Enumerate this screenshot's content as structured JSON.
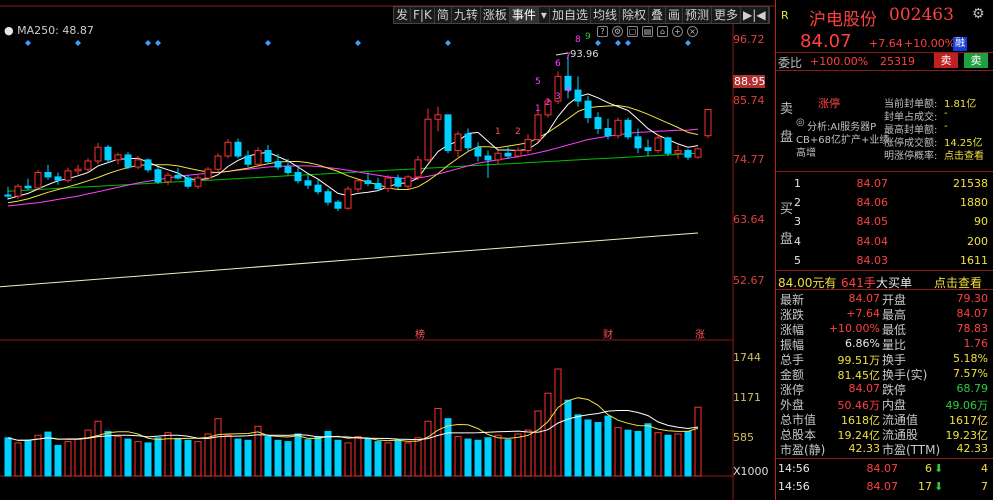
{
  "chart": {
    "ma_legend": "MA250: 48.87",
    "toolbar": [
      "发",
      "F|K",
      "简",
      "九转",
      "涨板",
      "事件",
      "▾",
      "加自选",
      "均线",
      "除权",
      "叠",
      "画",
      "预测",
      "更多",
      "▶|◀"
    ],
    "price_axis": [
      "96.72",
      "88.95",
      "85.74",
      "74.77",
      "63.64",
      "52.67"
    ],
    "vol_axis": [
      "1744",
      "1171",
      "585",
      "X1000"
    ],
    "peak_label": "93.96",
    "event_labels": [
      "榜",
      "财",
      "涨"
    ],
    "nine_turn_up": [
      "1",
      "2",
      "1",
      "2",
      "3",
      "4",
      "5",
      "6",
      "7",
      "8",
      "9"
    ],
    "colors": {
      "up": "#ff3030",
      "down": "#00d0ff",
      "ma5": "#ffffff",
      "ma10": "#f0e040",
      "ma20": "#ff40ff",
      "ma60": "#00c000",
      "ma250": "#f0f0c0"
    }
  },
  "chart_data": {
    "type": "candlestick",
    "price_range": [
      48,
      100
    ],
    "volume_range": [
      0,
      2000
    ],
    "candles": [
      {
        "o": 68.5,
        "h": 70.0,
        "l": 67.6,
        "c": 68.3
      },
      {
        "o": 68.3,
        "h": 70.5,
        "l": 67.8,
        "c": 70.1
      },
      {
        "o": 70.1,
        "h": 71.5,
        "l": 69.4,
        "c": 69.8
      },
      {
        "o": 69.8,
        "h": 73.0,
        "l": 69.4,
        "c": 72.6
      },
      {
        "o": 72.6,
        "h": 74.0,
        "l": 71.3,
        "c": 71.8
      },
      {
        "o": 71.8,
        "h": 72.6,
        "l": 70.4,
        "c": 71.2
      },
      {
        "o": 71.2,
        "h": 73.5,
        "l": 70.8,
        "c": 72.9
      },
      {
        "o": 72.9,
        "h": 74.0,
        "l": 72.2,
        "c": 73.2
      },
      {
        "o": 73.2,
        "h": 75.2,
        "l": 72.6,
        "c": 74.7
      },
      {
        "o": 74.7,
        "h": 78.0,
        "l": 74.1,
        "c": 77.2
      },
      {
        "o": 77.2,
        "h": 77.6,
        "l": 74.4,
        "c": 74.9
      },
      {
        "o": 74.9,
        "h": 76.2,
        "l": 74.1,
        "c": 75.8
      },
      {
        "o": 75.8,
        "h": 76.3,
        "l": 73.2,
        "c": 73.6
      },
      {
        "o": 73.6,
        "h": 75.6,
        "l": 73.2,
        "c": 74.9
      },
      {
        "o": 74.9,
        "h": 75.2,
        "l": 72.6,
        "c": 73.1
      },
      {
        "o": 73.1,
        "h": 73.6,
        "l": 70.5,
        "c": 70.9
      },
      {
        "o": 70.9,
        "h": 72.6,
        "l": 70.3,
        "c": 72.1
      },
      {
        "o": 72.1,
        "h": 73.4,
        "l": 71.3,
        "c": 71.6
      },
      {
        "o": 71.6,
        "h": 72.2,
        "l": 69.7,
        "c": 70.1
      },
      {
        "o": 70.1,
        "h": 72.1,
        "l": 69.6,
        "c": 71.6
      },
      {
        "o": 71.6,
        "h": 73.6,
        "l": 71.2,
        "c": 73.2
      },
      {
        "o": 73.2,
        "h": 76.1,
        "l": 72.6,
        "c": 75.6
      },
      {
        "o": 75.6,
        "h": 78.7,
        "l": 75.2,
        "c": 78.1
      },
      {
        "o": 78.1,
        "h": 78.8,
        "l": 75.2,
        "c": 75.6
      },
      {
        "o": 75.6,
        "h": 76.6,
        "l": 73.6,
        "c": 74.1
      },
      {
        "o": 74.1,
        "h": 77.2,
        "l": 73.6,
        "c": 76.6
      },
      {
        "o": 76.6,
        "h": 77.6,
        "l": 74.1,
        "c": 74.6
      },
      {
        "o": 74.6,
        "h": 76.0,
        "l": 73.1,
        "c": 73.6
      },
      {
        "o": 73.6,
        "h": 75.1,
        "l": 72.1,
        "c": 72.6
      },
      {
        "o": 72.6,
        "h": 73.6,
        "l": 70.6,
        "c": 71.1
      },
      {
        "o": 71.1,
        "h": 72.1,
        "l": 69.6,
        "c": 70.3
      },
      {
        "o": 70.3,
        "h": 71.3,
        "l": 68.6,
        "c": 69.1
      },
      {
        "o": 69.1,
        "h": 69.6,
        "l": 66.6,
        "c": 67.2
      },
      {
        "o": 67.2,
        "h": 67.6,
        "l": 65.6,
        "c": 66.1
      },
      {
        "o": 66.1,
        "h": 70.1,
        "l": 65.8,
        "c": 69.6
      },
      {
        "o": 69.6,
        "h": 71.6,
        "l": 69.1,
        "c": 71.1
      },
      {
        "o": 71.1,
        "h": 72.6,
        "l": 70.1,
        "c": 70.6
      },
      {
        "o": 70.6,
        "h": 71.6,
        "l": 69.2,
        "c": 69.7
      },
      {
        "o": 69.7,
        "h": 72.1,
        "l": 69.1,
        "c": 71.6
      },
      {
        "o": 71.6,
        "h": 72.2,
        "l": 69.6,
        "c": 70.1
      },
      {
        "o": 70.1,
        "h": 72.1,
        "l": 69.6,
        "c": 71.8
      },
      {
        "o": 71.8,
        "h": 75.6,
        "l": 71.2,
        "c": 74.9
      },
      {
        "o": 74.9,
        "h": 84.2,
        "l": 74.6,
        "c": 82.3
      },
      {
        "o": 82.3,
        "h": 84.6,
        "l": 80.1,
        "c": 83.1
      },
      {
        "o": 83.1,
        "h": 82.4,
        "l": 76.1,
        "c": 76.6
      },
      {
        "o": 76.6,
        "h": 80.1,
        "l": 75.1,
        "c": 79.6
      },
      {
        "o": 79.6,
        "h": 80.6,
        "l": 76.4,
        "c": 77.1
      },
      {
        "o": 77.1,
        "h": 78.1,
        "l": 74.6,
        "c": 75.6
      },
      {
        "o": 75.6,
        "h": 76.6,
        "l": 71.6,
        "c": 74.9
      },
      {
        "o": 74.9,
        "h": 76.6,
        "l": 74.1,
        "c": 76.1
      },
      {
        "o": 76.1,
        "h": 77.2,
        "l": 75.1,
        "c": 75.6
      },
      {
        "o": 75.6,
        "h": 77.2,
        "l": 75.2,
        "c": 76.6
      },
      {
        "o": 76.6,
        "h": 79.6,
        "l": 76.1,
        "c": 78.6
      },
      {
        "o": 78.6,
        "h": 84.1,
        "l": 78.1,
        "c": 83.1
      },
      {
        "o": 83.1,
        "h": 86.1,
        "l": 82.6,
        "c": 85.6
      },
      {
        "o": 85.6,
        "h": 91.0,
        "l": 85.1,
        "c": 90.1
      },
      {
        "o": 90.1,
        "h": 93.96,
        "l": 86.1,
        "c": 87.6
      },
      {
        "o": 87.6,
        "h": 90.1,
        "l": 84.6,
        "c": 85.6
      },
      {
        "o": 85.6,
        "h": 86.6,
        "l": 81.6,
        "c": 82.6
      },
      {
        "o": 82.6,
        "h": 83.6,
        "l": 79.6,
        "c": 80.6
      },
      {
        "o": 80.6,
        "h": 82.4,
        "l": 78.6,
        "c": 79.3
      },
      {
        "o": 79.3,
        "h": 82.6,
        "l": 78.8,
        "c": 82.1
      },
      {
        "o": 82.1,
        "h": 82.6,
        "l": 78.6,
        "c": 79.1
      },
      {
        "o": 79.1,
        "h": 80.6,
        "l": 76.1,
        "c": 77.1
      },
      {
        "o": 77.1,
        "h": 78.6,
        "l": 75.6,
        "c": 76.6
      },
      {
        "o": 76.6,
        "h": 79.6,
        "l": 76.1,
        "c": 78.9
      },
      {
        "o": 78.9,
        "h": 79.1,
        "l": 75.6,
        "c": 76.1
      },
      {
        "o": 76.1,
        "h": 77.6,
        "l": 75.1,
        "c": 76.6
      },
      {
        "o": 76.6,
        "h": 76.9,
        "l": 74.9,
        "c": 75.4
      },
      {
        "o": 75.4,
        "h": 77.1,
        "l": 75.1,
        "c": 76.9
      },
      {
        "o": 79.3,
        "h": 84.07,
        "l": 78.83,
        "c": 84.07
      }
    ],
    "volumes": [
      600,
      520,
      560,
      640,
      690,
      480,
      540,
      580,
      720,
      860,
      700,
      620,
      580,
      540,
      520,
      600,
      680,
      590,
      560,
      540,
      660,
      900,
      640,
      580,
      560,
      780,
      620,
      560,
      540,
      660,
      570,
      620,
      700,
      560,
      520,
      620,
      580,
      540,
      520,
      560,
      520,
      600,
      860,
      1060,
      900,
      620,
      580,
      560,
      600,
      640,
      570,
      660,
      720,
      1020,
      1300,
      1680,
      1190,
      960,
      880,
      840,
      940,
      760,
      720,
      700,
      820,
      680,
      640,
      660,
      700,
      1080
    ],
    "ma5": [
      67.8,
      68.3,
      68.8,
      69.6,
      70.4,
      71.1,
      71.5,
      72.0,
      72.6,
      73.8,
      74.4,
      75.0,
      75.1,
      75.2,
      74.5,
      73.7,
      73.1,
      72.5,
      71.5,
      71.3,
      71.5,
      72.2,
      73.7,
      74.8,
      75.6,
      76.0,
      76.3,
      75.5,
      74.7,
      73.6,
      72.4,
      71.4,
      70.1,
      68.8,
      68.4,
      68.8,
      69.0,
      69.3,
      70.0,
      70.6,
      70.7,
      71.6,
      74.1,
      76.4,
      77.6,
      78.3,
      79.7,
      79.9,
      78.3,
      76.7,
      76.7,
      76.6,
      76.8,
      78.0,
      80.0,
      82.8,
      85.0,
      86.4,
      86.9,
      86.2,
      85.3,
      84.6,
      83.9,
      82.3,
      80.6,
      79.4,
      78.6,
      77.8,
      77.2,
      77.5
    ],
    "ma10": [
      67.1,
      67.4,
      67.8,
      68.4,
      69.0,
      69.5,
      70.0,
      70.5,
      71.1,
      71.7,
      72.4,
      73.0,
      73.5,
      73.9,
      74.0,
      74.0,
      74.0,
      73.8,
      73.4,
      73.0,
      72.7,
      72.6,
      72.8,
      73.1,
      73.4,
      73.8,
      74.2,
      74.5,
      74.6,
      74.6,
      74.4,
      74.0,
      73.4,
      72.8,
      72.0,
      71.4,
      70.8,
      70.4,
      69.8,
      69.5,
      69.5,
      70.0,
      71.1,
      72.4,
      73.9,
      75.2,
      76.4,
      77.3,
      77.3,
      77.1,
      77.4,
      77.7,
      78.0,
      78.9,
      79.9,
      81.1,
      82.4,
      83.7,
      84.4,
      84.6,
      84.7,
      84.8,
      84.5,
      83.9,
      83.2,
      82.4,
      81.6,
      80.8,
      79.9,
      79.5
    ],
    "ma20": [
      66.5,
      66.7,
      66.9,
      67.1,
      67.4,
      67.7,
      68.0,
      68.3,
      68.7,
      69.1,
      69.5,
      69.9,
      70.3,
      70.7,
      71.0,
      71.3,
      71.6,
      71.9,
      72.1,
      72.3,
      72.5,
      72.6,
      72.8,
      73.0,
      73.2,
      73.4,
      73.6,
      73.7,
      73.8,
      73.8,
      73.8,
      73.7,
      73.5,
      73.3,
      73.0,
      72.7,
      72.4,
      72.1,
      71.8,
      71.6,
      71.5,
      71.6,
      71.9,
      72.3,
      72.8,
      73.3,
      73.8,
      74.3,
      74.6,
      74.9,
      75.2,
      75.5,
      75.8,
      76.2,
      76.6,
      77.1,
      77.6,
      78.1,
      78.6,
      78.9,
      79.2,
      79.5,
      79.7,
      79.9,
      80.0,
      80.1,
      80.2,
      80.3,
      80.3,
      80.5
    ],
    "ma60": [
      69.2,
      69.3,
      69.4,
      69.5,
      69.6,
      69.7,
      69.8,
      69.9,
      70.0,
      70.1,
      70.2,
      70.3,
      70.4,
      70.5,
      70.6,
      70.7,
      70.8,
      70.9,
      71.0,
      71.1,
      71.2,
      71.3,
      71.4,
      71.5,
      71.6,
      71.7,
      71.8,
      71.9,
      72.0,
      72.1,
      72.2,
      72.3,
      72.4,
      72.5,
      72.6,
      72.7,
      72.8,
      72.9,
      73.0,
      73.1,
      73.2,
      73.3,
      73.4,
      73.5,
      73.6,
      73.7,
      73.8,
      73.9,
      74.0,
      74.1,
      74.2,
      74.3,
      74.4,
      74.5,
      74.6,
      74.7,
      74.8,
      74.9,
      75.0,
      75.1,
      75.2,
      75.3,
      75.4,
      75.5,
      75.6,
      75.7,
      75.8,
      75.9,
      76.0,
      76.1
    ],
    "ma250_start": 51.8,
    "ma250_end": 61.6
  },
  "side": {
    "code_badge": "R",
    "name": "沪电股份",
    "code": "002463",
    "price": "84.07",
    "change": "+7.64",
    "change_pct": "+10.00%",
    "tag": "融",
    "weibi_label": "委比",
    "weibi_value": "+100.00%",
    "weicha_value": "25319",
    "sell_btn": "卖",
    "buy_btn": "卖",
    "sell_side_label": [
      "卖",
      "盘"
    ],
    "limit_label": "涨停",
    "limit_info": [
      {
        "k": "当前封单额:",
        "v": "1.81亿"
      },
      {
        "k": "封单占成交:",
        "v": "-"
      },
      {
        "k": "最高封单额:",
        "v": "-"
      },
      {
        "k": "涨停成交额:",
        "v": "14.25亿"
      },
      {
        "k": "明涨停概率:",
        "v": "点击查看"
      }
    ],
    "analysis": [
      "分析:AI服务器P",
      "CB+68亿扩产+业绩",
      "高增"
    ],
    "buy_side_label": [
      "买",
      "盘"
    ],
    "bids": [
      {
        "lvl": "1",
        "price": "84.07",
        "vol": "21538"
      },
      {
        "lvl": "2",
        "price": "84.06",
        "vol": "1880"
      },
      {
        "lvl": "3",
        "price": "84.05",
        "vol": "90"
      },
      {
        "lvl": "4",
        "price": "84.04",
        "vol": "200"
      },
      {
        "lvl": "5",
        "price": "84.03",
        "vol": "1611"
      }
    ],
    "bigorder": {
      "price": "84.00元有",
      "vol": "641手",
      "label": "大买单",
      "link": "点击查看"
    },
    "quotes": [
      {
        "l1": "最新",
        "v1": "84.07",
        "c1": "red",
        "l2": "开盘",
        "v2": "79.30",
        "c2": "red"
      },
      {
        "l1": "涨跌",
        "v1": "+7.64",
        "c1": "red",
        "l2": "最高",
        "v2": "84.07",
        "c2": "red"
      },
      {
        "l1": "涨幅",
        "v1": "+10.00%",
        "c1": "red",
        "l2": "最低",
        "v2": "78.83",
        "c2": "red"
      },
      {
        "l1": "振幅",
        "v1": "6.86%",
        "c1": "wht",
        "l2": "量比",
        "v2": "1.76",
        "c2": "red"
      },
      {
        "l1": "总手",
        "v1": "99.51万",
        "c1": "yel",
        "l2": "换手",
        "v2": "5.18%",
        "c2": "yel"
      },
      {
        "l1": "金额",
        "v1": "81.45亿",
        "c1": "yel",
        "l2": "换手(实)",
        "v2": "7.57%",
        "c2": "yel"
      },
      {
        "l1": "涨停",
        "v1": "84.07",
        "c1": "red",
        "l2": "跌停",
        "v2": "68.79",
        "c2": "grn"
      },
      {
        "l1": "外盘",
        "v1": "50.46万",
        "c1": "red",
        "l2": "内盘",
        "v2": "49.06万",
        "c2": "grn"
      },
      {
        "l1": "总市值",
        "v1": "1618亿",
        "c1": "yel",
        "l2": "流通值",
        "v2": "1617亿",
        "c2": "yel"
      },
      {
        "l1": "总股本",
        "v1": "19.24亿",
        "c1": "yel",
        "l2": "流通股",
        "v2": "19.23亿",
        "c2": "yel"
      },
      {
        "l1": "市盈(静)",
        "v1": "42.33",
        "c1": "yel",
        "l2": "市盈(TTM)",
        "v2": "42.33",
        "c2": "yel"
      }
    ],
    "ticks": [
      {
        "t": "14:56",
        "p": "84.07",
        "v": "6",
        "n": "4"
      },
      {
        "t": "14:56",
        "p": "84.07",
        "v": "17",
        "n": "7"
      }
    ]
  }
}
